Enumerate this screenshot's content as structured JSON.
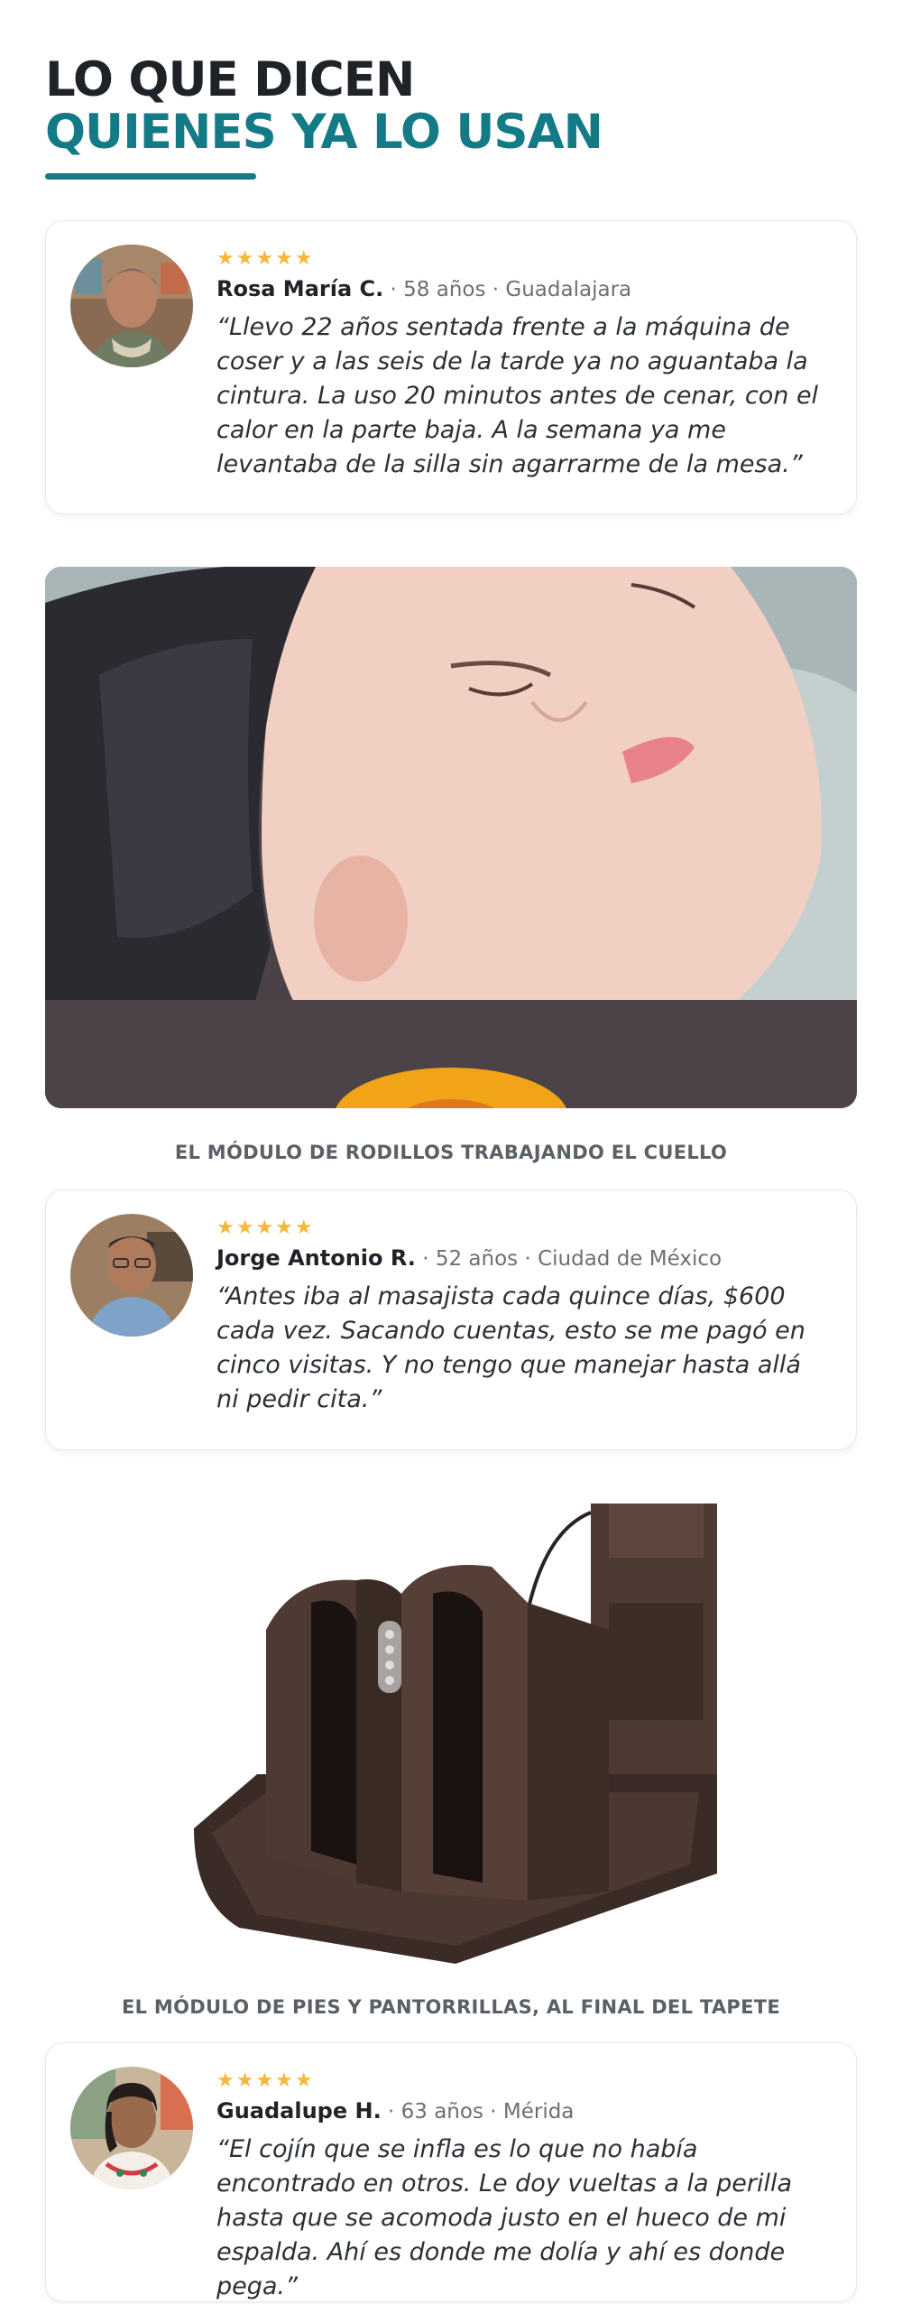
{
  "header": {
    "line1": "LO QUE DICEN",
    "line2": "QUIENES YA LO USAN"
  },
  "reviews": [
    {
      "stars": "★★★★★",
      "rating": 5,
      "name": "Rosa María C.",
      "info": "58 años · Guadalajara",
      "quote": "“Llevo 22 años sentada frente a la máquina de coser y a las seis de la tarde ya no aguantaba la cintura. La uso 20 minutos antes de cenar, con el calor en la parte baja. A la semana ya me levantaba de la silla sin agarrarme de la mesa.”"
    },
    {
      "stars": "★★★★★",
      "rating": 5,
      "name": "Jorge Antonio R.",
      "info": "52 años · Ciudad de México",
      "quote": "“Antes iba al masajista cada quince días, $600 cada vez. Sacando cuentas, esto se me pagó en cinco visitas. Y no tengo que manejar hasta allá ni pedir cita.”"
    },
    {
      "stars": "★★★★★",
      "rating": 5,
      "name": "Guadalupe H.",
      "info": "63 años · Mérida",
      "quote": "“El cojín que se infla es lo que no había encontrado en otros. Le doy vueltas a la perilla hasta que se acomoda justo en el hueco de mi espalda. Ahí es donde me dolía y ahí es donde pega.”"
    }
  ],
  "captions": {
    "neck": "EL MÓDULO DE RODILLOS TRABAJANDO EL CUELLO",
    "feet": "EL MÓDULO DE PIES Y PANTORRILLAS, AL FINAL DEL TAPETE"
  },
  "colors": {
    "teal": "#147a86",
    "dark": "#1f2328",
    "star": "#f6b83b"
  }
}
